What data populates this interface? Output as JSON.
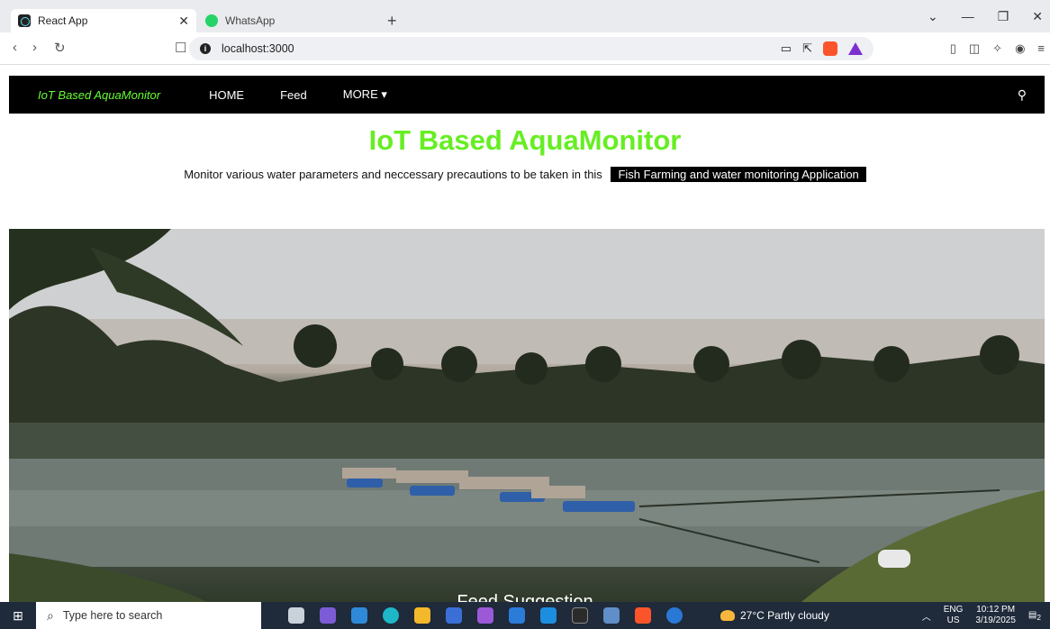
{
  "browser": {
    "tabs": [
      {
        "title": "React App",
        "active": true
      },
      {
        "title": "WhatsApp",
        "active": false
      }
    ],
    "url": "localhost:3000"
  },
  "app": {
    "brand": "IoT Based AquaMonitor",
    "nav": [
      "HOME",
      "Feed",
      "MORE"
    ],
    "hero_title": "IoT Based AquaMonitor",
    "hero_subtitle": "Monitor various water parameters and neccessary precautions to be taken in this",
    "hero_highlight": "Fish Farming and water monitoring Application",
    "carousel_caption": "Feed Suggestion"
  },
  "taskbar": {
    "search_placeholder": "Type here to search",
    "weather": "27°C  Partly cloudy",
    "lang_top": "ENG",
    "lang_bottom": "US",
    "time": "10:12 PM",
    "date": "3/19/2025",
    "notification_count": "2"
  },
  "colors": {
    "brand_green": "#66ff33",
    "title_green": "#66ee22",
    "navbar_bg": "#000000",
    "taskbar_bg": "#1f2a3a"
  }
}
